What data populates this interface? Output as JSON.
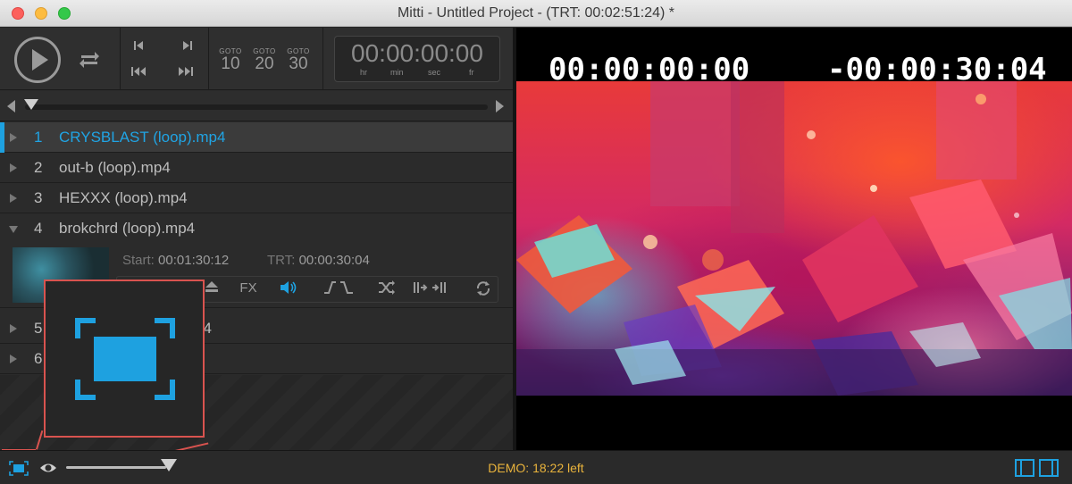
{
  "window": {
    "title": "Mitti - Untitled Project - (TRT: 00:02:51:24) *"
  },
  "transport": {
    "goto_label": "GOTO",
    "goto_values": [
      "10",
      "20",
      "30"
    ],
    "clock": "00:00:00:00",
    "clock_units": [
      "hr",
      "min",
      "sec",
      "fr"
    ]
  },
  "cues": [
    {
      "num": "1",
      "name": "CRYSBLAST (loop).mp4",
      "active": true
    },
    {
      "num": "2",
      "name": "out-b (loop).mp4"
    },
    {
      "num": "3",
      "name": "HEXXX (loop).mp4"
    },
    {
      "num": "4",
      "name": "brokchrd (loop).mp4",
      "expanded": true
    },
    {
      "num": "5",
      "name": "p4"
    },
    {
      "num": "6",
      "name": ""
    }
  ],
  "expanded_cue": {
    "start_label": "Start:",
    "start_value": "00:01:30:12",
    "trt_label": "TRT:",
    "trt_value": "00:00:30:04",
    "fx_label": "FX"
  },
  "video": {
    "elapsed": "00:00:00:00",
    "remaining": "-00:00:30:04"
  },
  "status": {
    "demo_text": "DEMO: 18:22 left",
    "accent": "#1ea1e0",
    "demo_color": "#e9b33c"
  },
  "icons": {
    "fullscreen": "fullscreen-icon",
    "preview": "eye-icon"
  }
}
